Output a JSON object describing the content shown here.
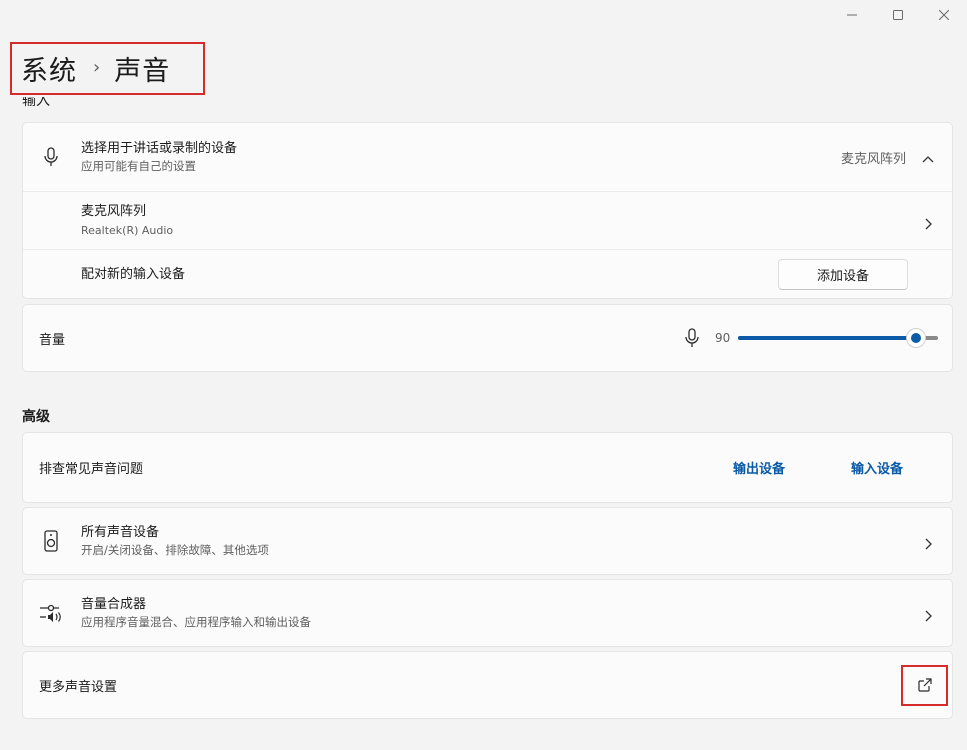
{
  "window": {
    "minimize_icon": "minimize-icon",
    "maximize_icon": "maximize-icon",
    "close_icon": "close-icon"
  },
  "breadcrumb": {
    "parent": "系统",
    "separator": "›",
    "current": "声音"
  },
  "input_section": {
    "heading": "输入",
    "device_select": {
      "title": "选择用于讲话或录制的设备",
      "subtitle": "应用可能有自己的设置",
      "selected_value": "麦克风阵列",
      "icon": "microphone-icon"
    },
    "device": {
      "title": "麦克风阵列",
      "subtitle": "Realtek(R) Audio"
    },
    "pair": {
      "title": "配对新的输入设备",
      "button_label": "添加设备"
    },
    "volume": {
      "label": "音量",
      "value": "90",
      "level_percent": 90,
      "icon": "microphone-icon"
    }
  },
  "advanced_section": {
    "heading": "高级",
    "troubleshoot": {
      "title": "排查常见声音问题",
      "link_output": "输出设备",
      "link_input": "输入设备"
    },
    "all_devices": {
      "title": "所有声音设备",
      "subtitle": "开启/关闭设备、排除故障、其他选项",
      "icon": "speaker-icon"
    },
    "mixer": {
      "title": "音量合成器",
      "subtitle": "应用程序音量混合、应用程序输入和输出设备",
      "icon": "mixer-icon"
    },
    "more_settings": {
      "title": "更多声音设置",
      "icon": "external-link-icon"
    }
  },
  "colors": {
    "accent": "#0a5aa7",
    "highlight_border": "#d62b2b",
    "background": "#f3f3f3",
    "card": "#fbfbfb"
  }
}
